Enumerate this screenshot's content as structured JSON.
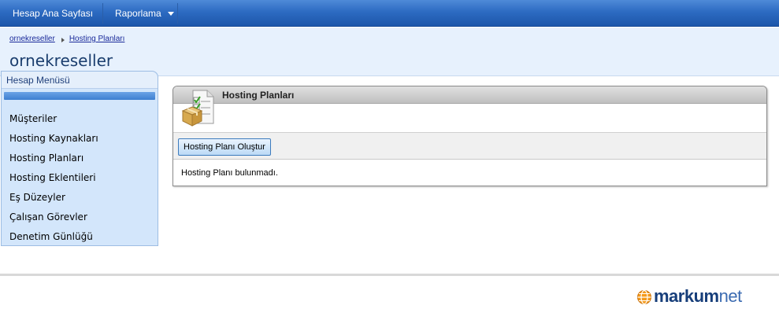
{
  "topnav": {
    "home_label": "Hesap Ana Sayfası",
    "reports_label": "Raporlama"
  },
  "breadcrumb": {
    "items": [
      "ornekreseller",
      "Hosting Planları"
    ]
  },
  "page": {
    "title": "ornekreseller"
  },
  "sidebar": {
    "header": "Hesap Menüsü",
    "items": [
      "Müşteriler",
      "Hosting Kaynakları",
      "Hosting Planları",
      "Hosting Eklentileri",
      "Eş Düzeyler",
      "Çalışan Görevler",
      "Denetim Günlüğü"
    ]
  },
  "panel": {
    "title": "Hosting Planları",
    "icon": "hosting-plans-box-icon",
    "create_button": "Hosting Planı Oluştur",
    "empty_message": "Hosting Planı bulunmadı."
  },
  "footer": {
    "logo_text": "markum",
    "logo_text_suffix": "net"
  },
  "colors": {
    "nav_blue": "#2d6bc2",
    "header_band": "#e7f1fd",
    "sidebar_bg": "#d3e6fb",
    "title_blue": "#1b3e6e"
  }
}
